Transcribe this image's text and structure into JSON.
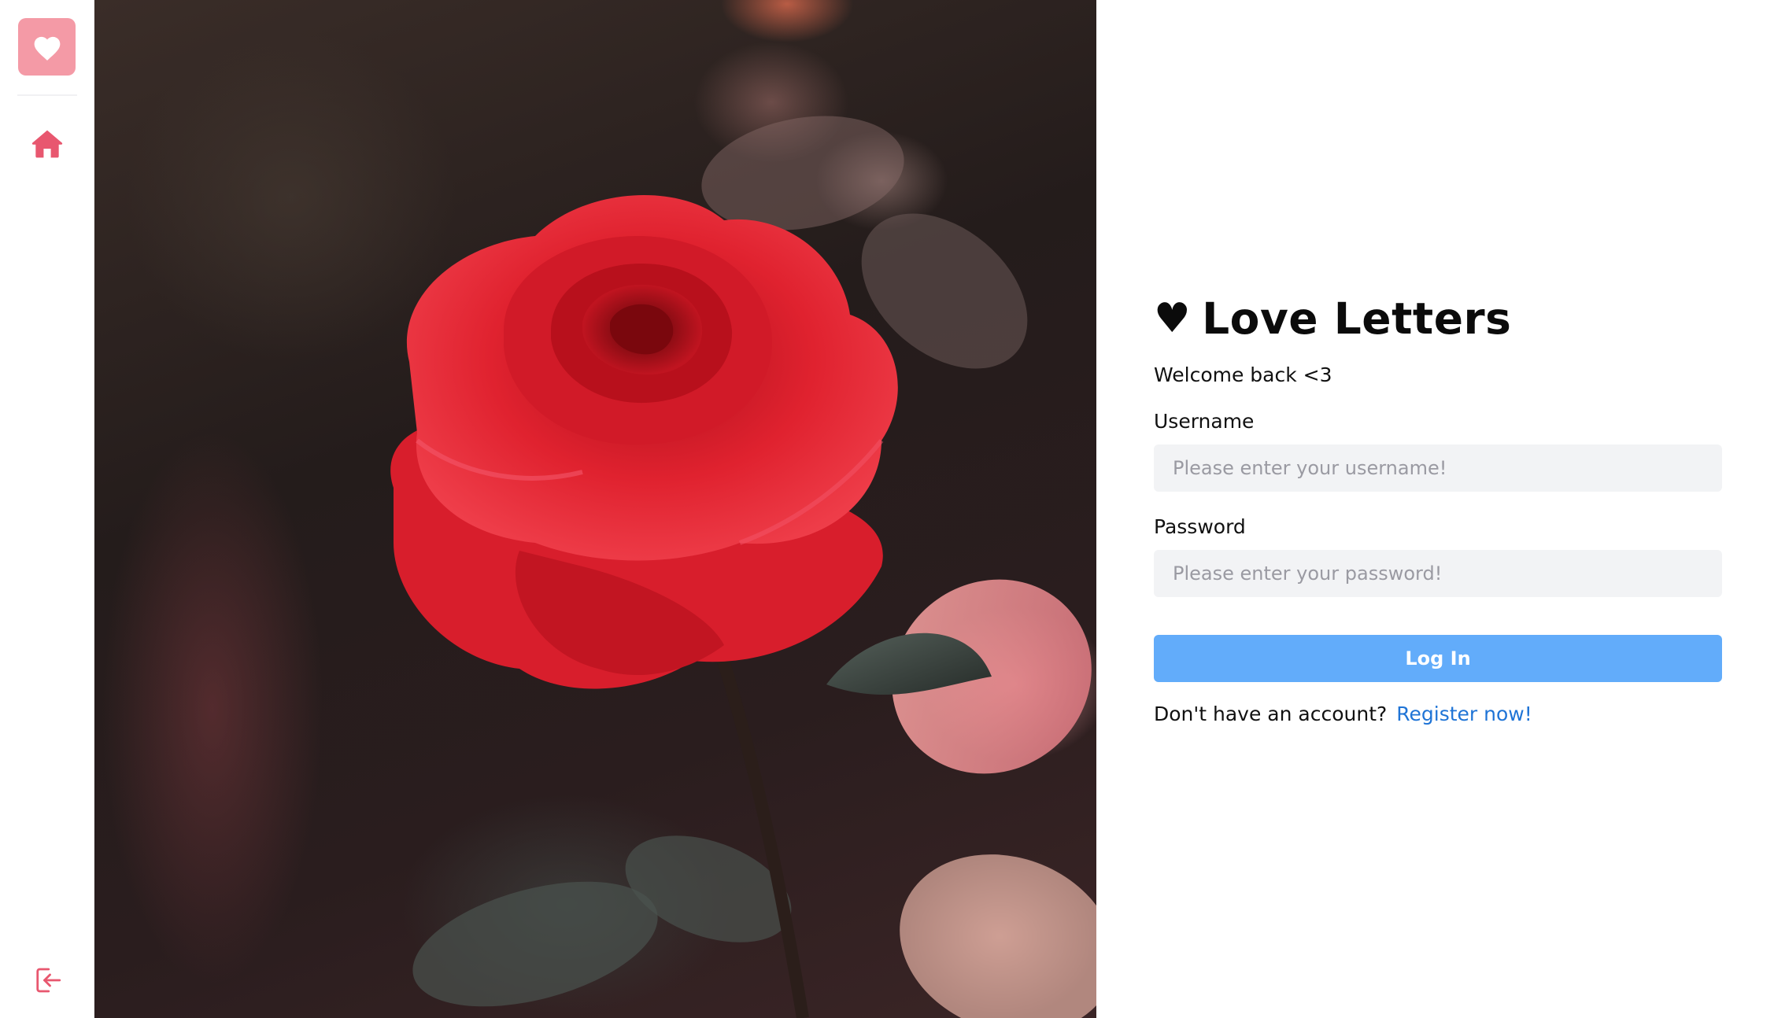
{
  "app": {
    "logo_icon": "heart-icon",
    "accent_color": "#f49aa6",
    "nav_color": "#e8576f"
  },
  "sidebar": {
    "items": [
      {
        "name": "home",
        "icon": "home-icon"
      },
      {
        "name": "logout",
        "icon": "logout-icon"
      }
    ]
  },
  "hero": {
    "image_subject": "red rose photograph"
  },
  "login": {
    "title_symbol": "♥",
    "title": "Love Letters",
    "subtitle": "Welcome back <3",
    "username_label": "Username",
    "username_placeholder": "Please enter your username!",
    "username_value": "",
    "password_label": "Password",
    "password_placeholder": "Please enter your password!",
    "password_value": "",
    "submit_label": "Log In",
    "submit_color": "#62acfa",
    "register_prompt": "Don't have an account?",
    "register_link": "Register now!",
    "link_color": "#1f74d6"
  }
}
